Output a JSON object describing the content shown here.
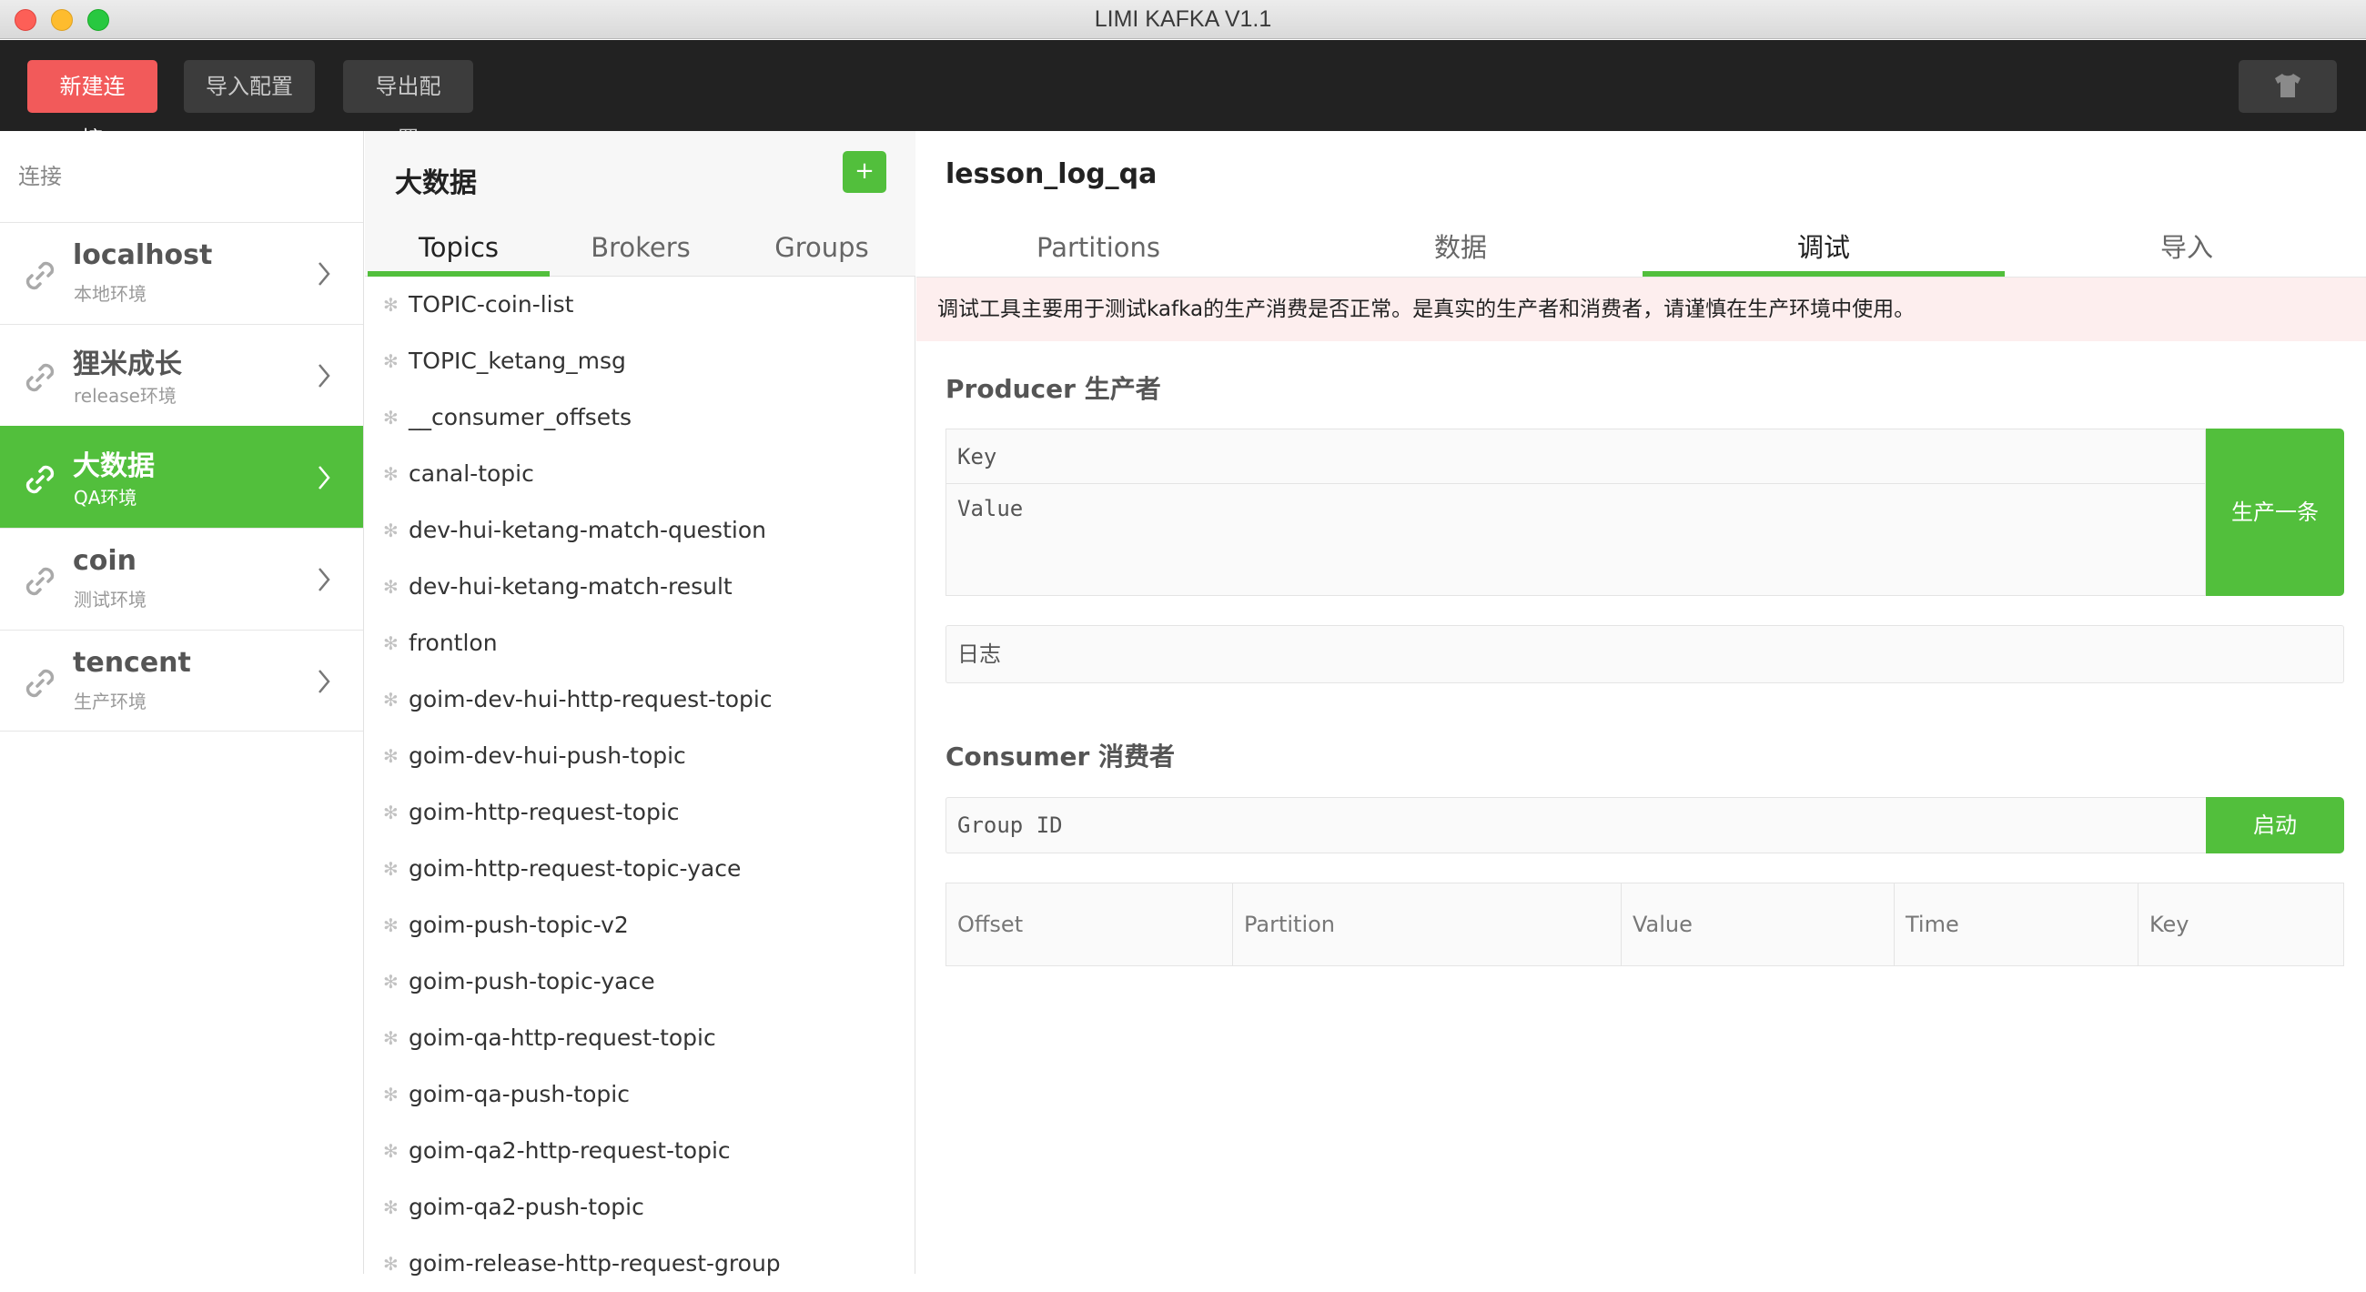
{
  "window": {
    "title": "LIMI KAFKA V1.1"
  },
  "toolbar": {
    "new_connection": "新建连接",
    "import_config": "导入配置",
    "export_config": "导出配置",
    "theme_icon": "tshirt-icon"
  },
  "sidebar": {
    "header": "连接",
    "items": [
      {
        "name": "localhost",
        "env": "本地环境",
        "active": false
      },
      {
        "name": "狸米成长",
        "env": "release环境",
        "active": false
      },
      {
        "name": "大数据",
        "env": "QA环境",
        "active": true
      },
      {
        "name": "coin",
        "env": "测试环境",
        "active": false
      },
      {
        "name": "tencent",
        "env": "生产环境",
        "active": false
      }
    ]
  },
  "topics_panel": {
    "title": "大数据",
    "add_label": "+",
    "tabs": [
      {
        "label": "Topics",
        "active": true
      },
      {
        "label": "Brokers",
        "active": false
      },
      {
        "label": "Groups",
        "active": false
      }
    ],
    "topics": [
      "TOPIC-coin-list",
      "TOPIC_ketang_msg",
      "__consumer_offsets",
      "canal-topic",
      "dev-hui-ketang-match-question",
      "dev-hui-ketang-match-result",
      "frontlon",
      "goim-dev-hui-http-request-topic",
      "goim-dev-hui-push-topic",
      "goim-http-request-topic",
      "goim-http-request-topic-yace",
      "goim-push-topic-v2",
      "goim-push-topic-yace",
      "goim-qa-http-request-topic",
      "goim-qa-push-topic",
      "goim-qa2-http-request-topic",
      "goim-qa2-push-topic",
      "goim-release-http-request-group"
    ]
  },
  "detail": {
    "title": "lesson_log_qa",
    "tabs": [
      {
        "label": "Partitions",
        "active": false
      },
      {
        "label": "数据",
        "active": false
      },
      {
        "label": "调试",
        "active": true
      },
      {
        "label": "导入",
        "active": false
      }
    ],
    "alert": "调试工具主要用于测试kafka的生产消费是否正常。是真实的生产者和消费者，请谨慎在生产环境中使用。",
    "producer": {
      "title": "Producer 生产者",
      "key_placeholder": "Key",
      "value_placeholder": "Value",
      "produce_button": "生产一条",
      "log_placeholder": "日志"
    },
    "consumer": {
      "title": "Consumer 消费者",
      "group_placeholder": "Group ID",
      "start_button": "启动",
      "columns": [
        "Offset",
        "Partition",
        "Value",
        "Time",
        "Key"
      ]
    }
  },
  "colors": {
    "accent": "#52bf3c",
    "primary_button": "#f25a5a",
    "toolbar_bg": "#222222",
    "alert_bg": "#fdeeee"
  }
}
